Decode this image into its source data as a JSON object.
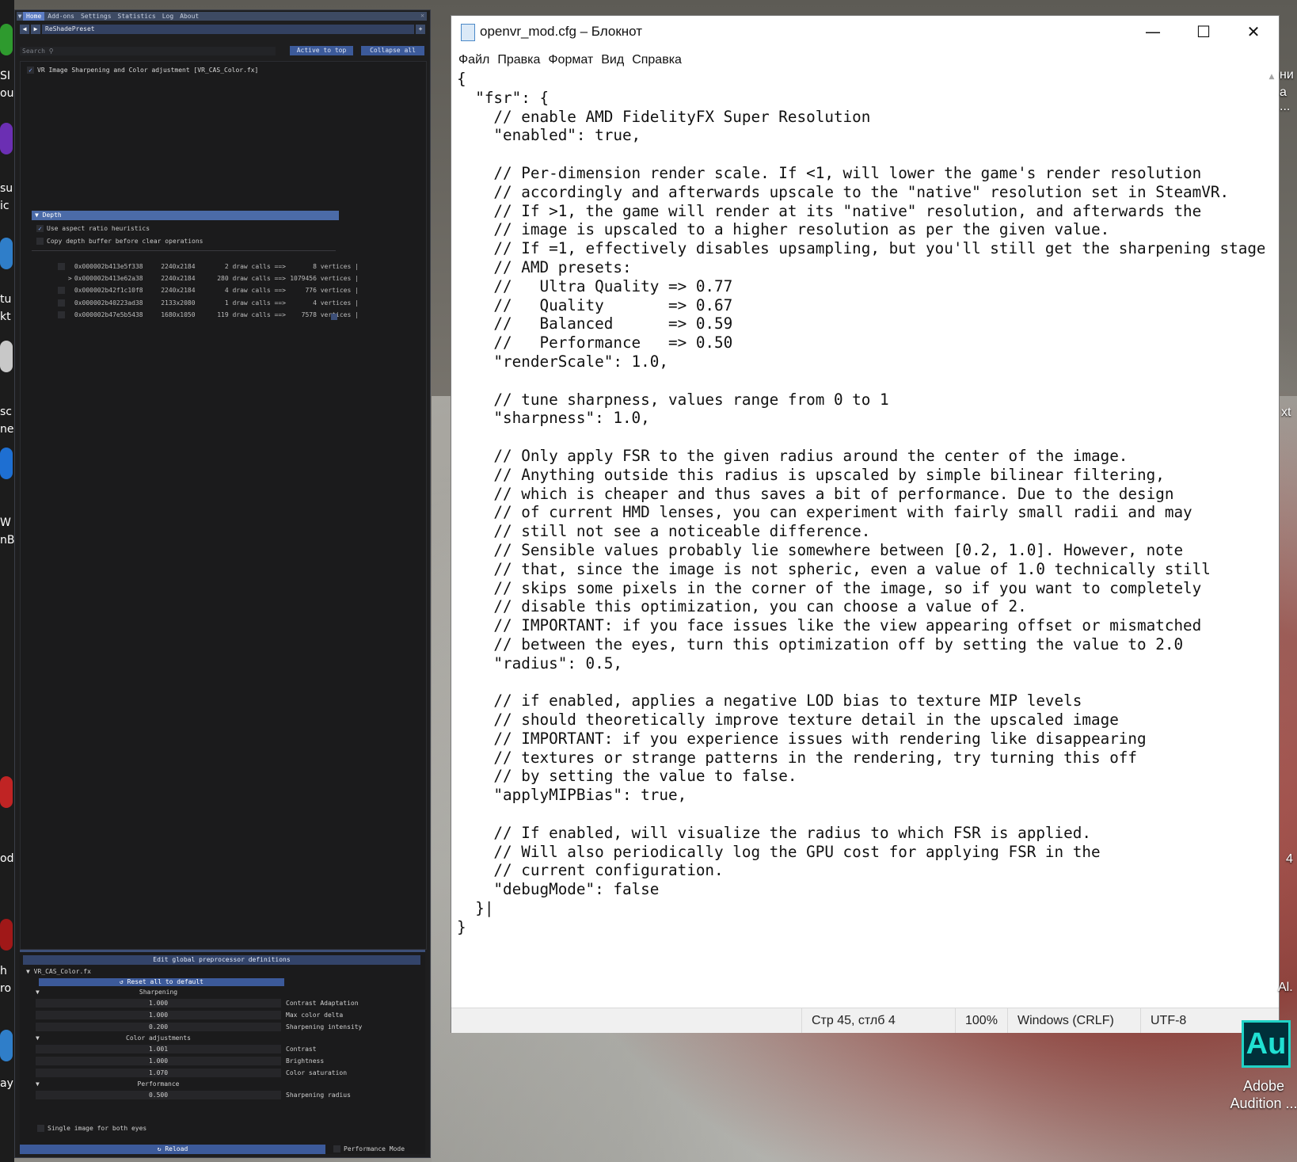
{
  "reshade": {
    "menu_tabs": [
      "Home",
      "Add-ons",
      "Settings",
      "Statistics",
      "Log",
      "About"
    ],
    "preset_name": "ReShadePreset",
    "search_placeholder": "Search",
    "active_to_top_label": "Active to top",
    "collapse_all_label": "Collapse all",
    "effect_label": "VR Image Sharpening and Color adjustment [VR_CAS_Color.fx]",
    "depth_header": "Depth",
    "depth_options": [
      "Use aspect ratio heuristics",
      "Copy depth buffer before clear operations"
    ],
    "depth_buffers": [
      {
        "marker": " ",
        "address": "0x000002b413e5f338",
        "resolution": "2240x2184",
        "draw_calls": "2 draw calls ==>",
        "vertices": "8 vertices |"
      },
      {
        "marker": ">",
        "address": "0x000002b413e62a38",
        "resolution": "2240x2184",
        "draw_calls": "280 draw calls ==>",
        "vertices": "1079456 vertices |"
      },
      {
        "marker": " ",
        "address": "0x000002b42f1c10f8",
        "resolution": "2240x2184",
        "draw_calls": "4 draw calls ==>",
        "vertices": "776 vertices |"
      },
      {
        "marker": " ",
        "address": "0x000002b40223ad38",
        "resolution": "2133x2080",
        "draw_calls": "1 draw calls ==>",
        "vertices": "4 vertices |"
      },
      {
        "marker": " ",
        "address": "0x000002b47e5b5438",
        "resolution": "1680x1050",
        "draw_calls": "119 draw calls ==>",
        "vertices": "7578 vertices |"
      }
    ],
    "preprocessor_label": "Edit global preprocessor definitions",
    "fx_file": "VR_CAS_Color.fx",
    "reset_label": "Reset all to default",
    "categories": [
      "Sharpening",
      "Color adjustments",
      "Performance"
    ],
    "sharpening_params": [
      {
        "value": "1.000",
        "label": "Contrast Adaptation"
      },
      {
        "value": "1.000",
        "label": "Max color delta"
      },
      {
        "value": "0.200",
        "label": "Sharpening intensity"
      }
    ],
    "color_params": [
      {
        "value": "1.001",
        "label": "Contrast"
      },
      {
        "value": "1.000",
        "label": "Brightness"
      },
      {
        "value": "1.070",
        "label": "Color saturation"
      }
    ],
    "performance_params": [
      {
        "value": "0.500",
        "label": "Sharpening radius"
      }
    ],
    "single_image_label": "Single image for both eyes",
    "reload_label": "Reload",
    "performance_mode_label": "Performance Mode"
  },
  "notepad": {
    "title": "openvr_mod.cfg – Блокнот",
    "menu": [
      "Файл",
      "Правка",
      "Формат",
      "Вид",
      "Справка"
    ],
    "content": "{\n  \"fsr\": {\n    // enable AMD FidelityFX Super Resolution\n    \"enabled\": true,\n\n    // Per-dimension render scale. If <1, will lower the game's render resolution\n    // accordingly and afterwards upscale to the \"native\" resolution set in SteamVR.\n    // If >1, the game will render at its \"native\" resolution, and afterwards the\n    // image is upscaled to a higher resolution as per the given value.\n    // If =1, effectively disables upsampling, but you'll still get the sharpening stage.\n    // AMD presets:\n    //   Ultra Quality => 0.77\n    //   Quality       => 0.67\n    //   Balanced      => 0.59\n    //   Performance   => 0.50\n    \"renderScale\": 1.0,\n\n    // tune sharpness, values range from 0 to 1\n    \"sharpness\": 1.0,\n\n    // Only apply FSR to the given radius around the center of the image.\n    // Anything outside this radius is upscaled by simple bilinear filtering,\n    // which is cheaper and thus saves a bit of performance. Due to the design\n    // of current HMD lenses, you can experiment with fairly small radii and may\n    // still not see a noticeable difference.\n    // Sensible values probably lie somewhere between [0.2, 1.0]. However, note\n    // that, since the image is not spheric, even a value of 1.0 technically still\n    // skips some pixels in the corner of the image, so if you want to completely\n    // disable this optimization, you can choose a value of 2.\n    // IMPORTANT: if you face issues like the view appearing offset or mismatched\n    // between the eyes, turn this optimization off by setting the value to 2.0\n    \"radius\": 0.5,\n\n    // if enabled, applies a negative LOD bias to texture MIP levels\n    // should theoretically improve texture detail in the upscaled image\n    // IMPORTANT: if you experience issues with rendering like disappearing\n    // textures or strange patterns in the rendering, try turning this off\n    // by setting the value to false.\n    \"applyMIPBias\": true,\n\n    // If enabled, will visualize the radius to which FSR is applied.\n    // Will also periodically log the GPU cost for applying FSR in the\n    // current configuration.\n    \"debugMode\": false\n  }|\n}",
    "status": {
      "position": "Стр 45, стлб 4",
      "zoom": "100%",
      "line_endings": "Windows (CRLF)",
      "encoding": "UTF-8"
    }
  },
  "desktop": {
    "audition_icon_text": "Au",
    "audition_label": "Adobe Audition ...",
    "right_edge_labels": [
      "ни",
      "а ...",
      "xt",
      "4",
      "Al."
    ],
    "left_edge_labels": [
      "SI",
      "ou",
      "su",
      "ic",
      "tu",
      "kt",
      "sc",
      "ne",
      "W",
      "nB",
      "od",
      "h",
      "ro",
      "ay"
    ]
  }
}
